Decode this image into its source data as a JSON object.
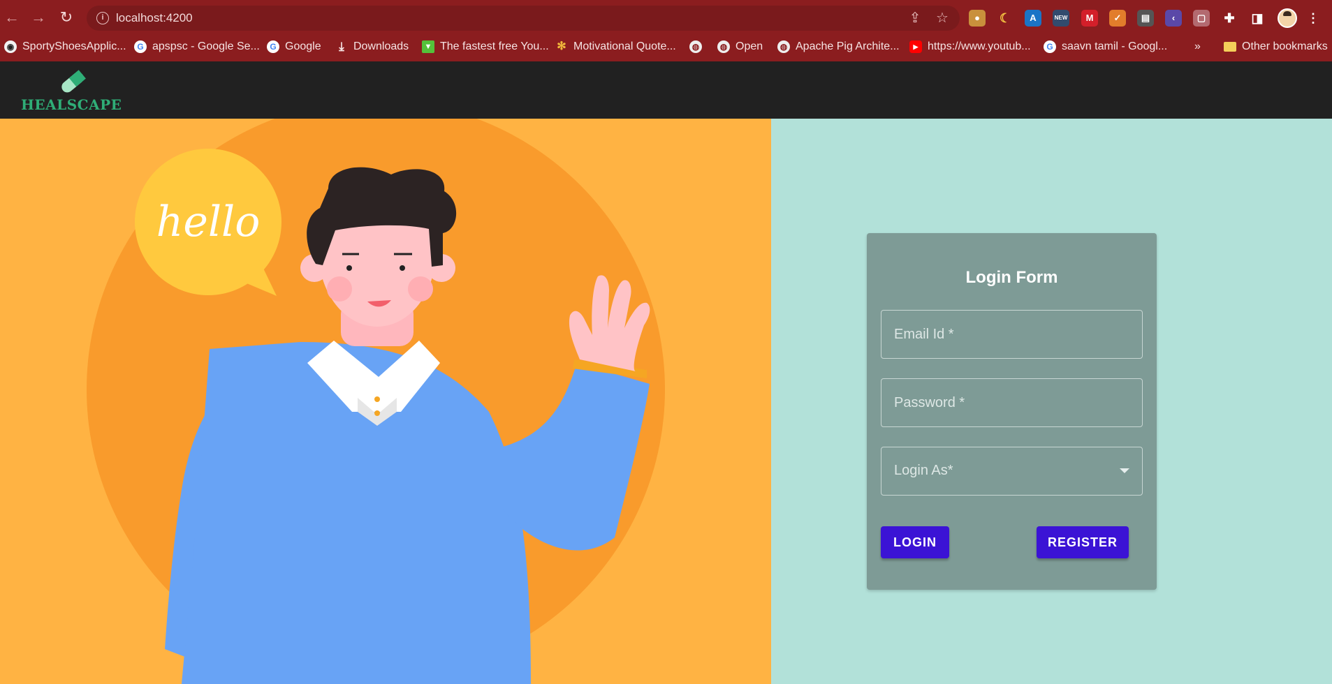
{
  "browser": {
    "url": "localhost:4200",
    "nav_icons": [
      "back-arrow-icon",
      "forward-arrow-icon",
      "reload-icon"
    ],
    "bookmarks": [
      {
        "label": "SportyShoesApplic...",
        "icon": "github-icon"
      },
      {
        "label": "apspsc - Google Se...",
        "icon": "google-icon"
      },
      {
        "label": "Google",
        "icon": "google-icon"
      },
      {
        "label": "Downloads",
        "icon": "download-icon"
      },
      {
        "label": "The fastest free You...",
        "icon": "green-arrow-icon"
      },
      {
        "label": "Motivational Quote...",
        "icon": "pinwheel-icon"
      },
      {
        "label": "",
        "icon": "globe-icon"
      },
      {
        "label": "Open",
        "icon": "globe-icon"
      },
      {
        "label": "Apache Pig Archite...",
        "icon": "globe-icon"
      },
      {
        "label": "https://www.youtub...",
        "icon": "youtube-icon"
      },
      {
        "label": "saavn tamil - Googl...",
        "icon": "google-icon"
      }
    ],
    "more_bookmarks": "»",
    "other_bookmarks": "Other bookmarks"
  },
  "app": {
    "brand": "HEALSCAPE",
    "hero_bubble_text": "hello",
    "login": {
      "title": "Login Form",
      "email_placeholder": "Email Id *",
      "password_placeholder": "Password *",
      "role_placeholder": "Login As*",
      "login_label": "LOGIN",
      "register_label": "REGISTER"
    }
  },
  "colors": {
    "chrome": "#8b1d1f",
    "navbar": "#212121",
    "hero_bg": "#ffb343",
    "panel_bg": "#b2e1d9",
    "card_bg": "#7e9b96",
    "button": "#3b13d5",
    "brand": "#2fae77"
  }
}
